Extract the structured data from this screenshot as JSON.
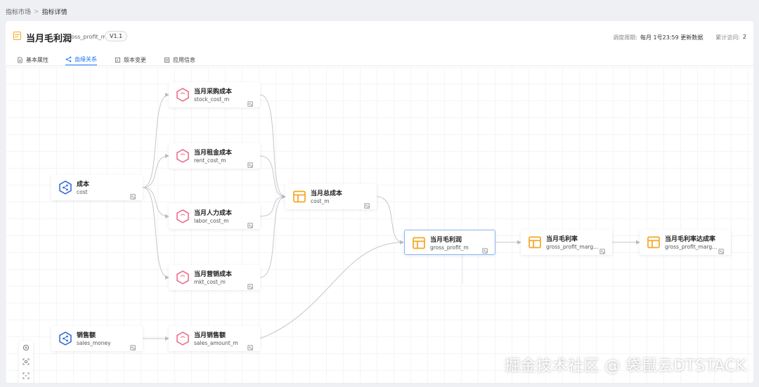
{
  "breadcrumb": {
    "root": "指标市场",
    "current": "指标详情"
  },
  "header": {
    "title": "当月毛利润",
    "code": "gross_profit_m",
    "version": "V1.1",
    "schedule_label": "调度周期:",
    "schedule_value": "每月 1号23:59 更新数据",
    "visits_label": "累计访问:",
    "visits_value": "2"
  },
  "tabs": [
    {
      "label": "基本属性",
      "icon": "document-icon"
    },
    {
      "label": "血缘关系",
      "icon": "lineage-icon",
      "active": true
    },
    {
      "label": "版本变更",
      "icon": "version-icon"
    },
    {
      "label": "应用信息",
      "icon": "app-info-icon"
    }
  ],
  "nodes": [
    {
      "id": "stock",
      "name": "当月采购成本",
      "code": "stock_cost_m",
      "kind": "derived"
    },
    {
      "id": "rent",
      "name": "当月租金成本",
      "code": "rent_cost_m",
      "kind": "derived"
    },
    {
      "id": "cost",
      "name": "成本",
      "code": "cost",
      "kind": "atomic"
    },
    {
      "id": "labor",
      "name": "当月人力成本",
      "code": "labor_cost_m",
      "kind": "derived"
    },
    {
      "id": "mkt",
      "name": "当月营销成本",
      "code": "mkt_cost_m",
      "kind": "derived"
    },
    {
      "id": "totalcost",
      "name": "当月总成本",
      "code": "cost_m",
      "kind": "composite"
    },
    {
      "id": "gp",
      "name": "当月毛利润",
      "code": "gross_profit_m",
      "kind": "composite",
      "selected": true
    },
    {
      "id": "gpr",
      "name": "当月毛利率",
      "code": "gross_profit_margin_m",
      "kind": "composite"
    },
    {
      "id": "gprr",
      "name": "当月毛利率达成率",
      "code": "gross_profit_margin_rate_m",
      "kind": "composite"
    },
    {
      "id": "sales",
      "name": "销售额",
      "code": "sales_money",
      "kind": "atomic"
    },
    {
      "id": "salesm",
      "name": "当月销售额",
      "code": "sales_amount_m",
      "kind": "derived"
    }
  ],
  "colors": {
    "atomic": "#3b6fd4",
    "derived": "#ec6f8c",
    "composite": "#f5a623",
    "accent": "#1677ff"
  },
  "toolbar": [
    "zoom-in-icon",
    "focus-icon",
    "fit-view-icon",
    "center-icon"
  ],
  "watermark": "掘金技术社区 @ 袋鼠云DTSTACK"
}
